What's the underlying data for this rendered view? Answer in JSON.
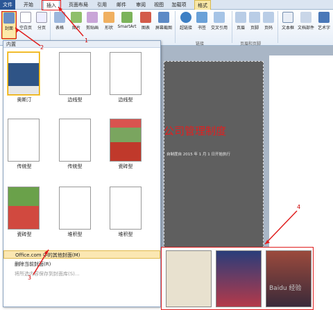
{
  "ribbon": {
    "tabs": [
      {
        "label": "文件"
      },
      {
        "label": "开始"
      },
      {
        "label": "插入"
      },
      {
        "label": "页面布局"
      },
      {
        "label": "引用"
      },
      {
        "label": "邮件"
      },
      {
        "label": "审阅"
      },
      {
        "label": "视图"
      },
      {
        "label": "加载项"
      },
      {
        "label": "格式"
      }
    ],
    "buttons": [
      {
        "label": "封面"
      },
      {
        "label": "空白页"
      },
      {
        "label": "分页"
      },
      {
        "label": "表格"
      },
      {
        "label": "图片"
      },
      {
        "label": "剪贴画"
      },
      {
        "label": "形状"
      },
      {
        "label": "SmartArt"
      },
      {
        "label": "图表"
      },
      {
        "label": "屏幕截图"
      },
      {
        "label": "超链接"
      },
      {
        "label": "书签"
      },
      {
        "label": "交叉引用"
      },
      {
        "label": "页眉"
      },
      {
        "label": "页脚"
      },
      {
        "label": "页码"
      },
      {
        "label": "文本框"
      },
      {
        "label": "文档部件"
      },
      {
        "label": "艺术字"
      }
    ],
    "groups": [
      {
        "label": "链接"
      },
      {
        "label": "页眉和页脚"
      }
    ]
  },
  "gallery": {
    "header": "内置",
    "items": [
      {
        "label": "奥斯汀"
      },
      {
        "label": "边线型"
      },
      {
        "label": "边线型"
      },
      {
        "label": "传统型"
      },
      {
        "label": "传统型"
      },
      {
        "label": "瓷砖型"
      },
      {
        "label": "瓷砖型"
      },
      {
        "label": "堆积型"
      },
      {
        "label": "堆积型"
      }
    ],
    "menu": [
      {
        "label": "Office.com 中的其他封面(M)"
      },
      {
        "label": "删除当前封面(R)"
      },
      {
        "label": "将所选内容保存到封面库(S)..."
      }
    ]
  },
  "document": {
    "title": "公司管理制度",
    "subtitle": "自制度自 2015 年 1 月 1 日开始执行"
  },
  "annotations": [
    "1",
    "2",
    "3",
    "4"
  ],
  "watermark": "Baidu 经验",
  "colors": {
    "accent_red": "#e01e1e",
    "file_tab": "#2b5797",
    "highlight": "#fbe7b2",
    "document_title": "#e02020"
  }
}
